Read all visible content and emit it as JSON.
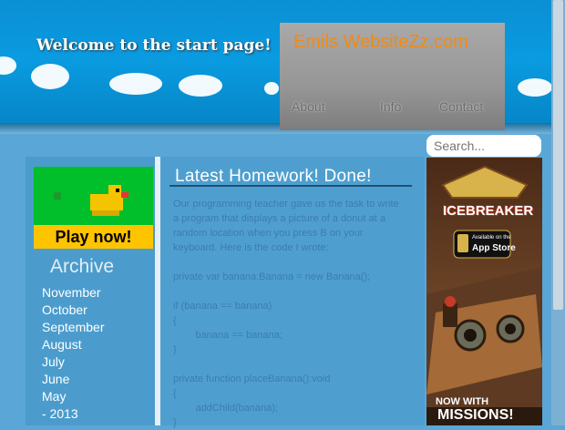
{
  "header": {
    "welcome_text": "Welcome to the start page!",
    "brand": "Emils WebsiteZz.com",
    "nav": [
      "About",
      "Info",
      "Contact"
    ]
  },
  "search": {
    "placeholder": "Search..."
  },
  "ad_left": {
    "label": "Play now!"
  },
  "archive": {
    "title": "Archive",
    "months": [
      "November",
      "October",
      "September",
      "August",
      "July",
      "June",
      "May",
      "- 2013"
    ]
  },
  "post": {
    "title": "Latest Homework! Done!",
    "intro": "Our programming teacher gave us the task to write a program that displays a picture of a donut at a random location when you press B on your keyboard. Here is the code I wrote:",
    "code": [
      "private var banana:Banana = new Banana();",
      "",
      "if (banana == banana)",
      "{",
      "        banana == banana;",
      "}",
      "",
      "private function placeBanana():void",
      "{",
      "        addChild(banana);",
      "}"
    ]
  },
  "ad_right": {
    "title": "ICEBREAKER",
    "store_small": "Available on the",
    "store": "App Store",
    "tagline1": "NOW WITH",
    "tagline2": "MISSIONS!"
  },
  "colors": {
    "brand": "#f08a19",
    "page_bg": "#5aa6d6",
    "play_green": "#00bf2a",
    "play_yellow": "#ffc400"
  }
}
